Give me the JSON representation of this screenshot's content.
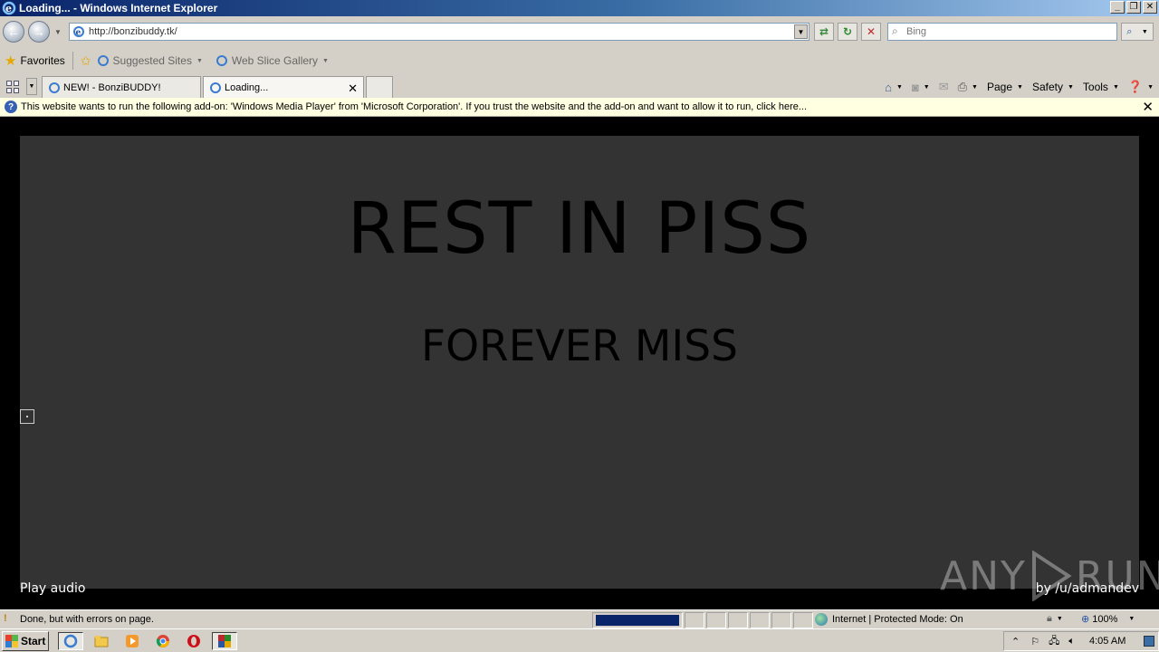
{
  "window": {
    "title": "Loading... - Windows Internet Explorer"
  },
  "nav": {
    "url": "http://bonzibuddy.tk/",
    "search_placeholder": "Bing"
  },
  "favorites": {
    "label": "Favorites",
    "suggested": "Suggested Sites",
    "webslice": "Web Slice Gallery"
  },
  "tabs": [
    {
      "label": "NEW! - BonziBUDDY!"
    },
    {
      "label": "Loading..."
    }
  ],
  "commands": {
    "page": "Page",
    "safety": "Safety",
    "tools": "Tools"
  },
  "infobar": {
    "message": "This website wants to run the following add-on: 'Windows Media Player' from 'Microsoft Corporation'. If you trust the website and the add-on and want to allow it to run, click here..."
  },
  "content": {
    "headline": "REST IN PISS",
    "subheadline": "FOREVER MISS",
    "play_audio": "Play audio",
    "byline": "by /u/admandev",
    "watermark_left": "ANY",
    "watermark_right": "RUN"
  },
  "status": {
    "text": "Done, but with errors on page.",
    "zone": "Internet | Protected Mode: On",
    "zoom": "100%",
    "progress_fraction": 1.0
  },
  "taskbar": {
    "start": "Start",
    "clock": "4:05 AM"
  },
  "colors": {
    "title_gradient_start": "#0a246a",
    "panel_bg": "#333333",
    "page_bg": "#000000",
    "infobar_bg": "#ffffe1",
    "progress_fill": "#0a246a"
  }
}
